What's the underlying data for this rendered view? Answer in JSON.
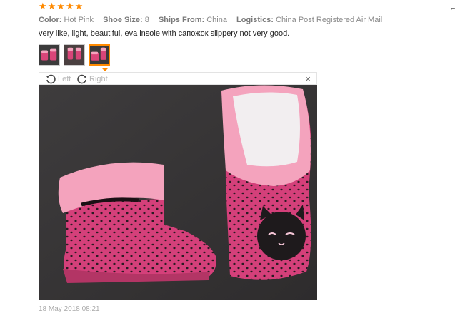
{
  "review": {
    "rating": 5,
    "stars": [
      "★",
      "★",
      "★",
      "★",
      "★"
    ],
    "meta": {
      "color_label": "Color:",
      "color_value": "Hot Pink",
      "size_label": "Shoe Size:",
      "size_value": "8",
      "ships_label": "Ships From:",
      "ships_value": "China",
      "logistics_label": "Logistics:",
      "logistics_value": "China Post Registered Air Mail"
    },
    "text": "very like, light, beautiful, eva insole with сапожок slippery not very good.",
    "date": "18 May 2018 08:21",
    "thumbnails_count": 3,
    "selected_thumbnail": 3
  },
  "viewer": {
    "rotate_left_label": "Left",
    "rotate_right_label": "Right",
    "close_label": "×"
  },
  "page": {
    "corner_icon": "⌐"
  },
  "colors": {
    "accent": "#ff8a00",
    "boot_pink": "#e0487a",
    "cuff_pink": "#f4a3bd"
  }
}
